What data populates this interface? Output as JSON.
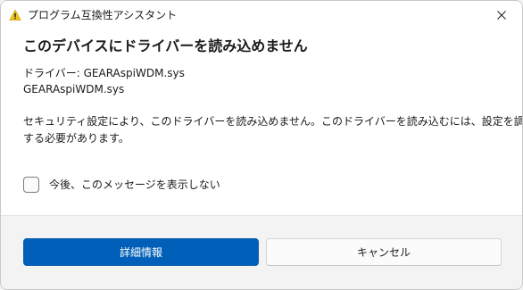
{
  "window": {
    "title": "プログラム互換性アシスタント"
  },
  "dialog": {
    "heading": "このデバイスにドライバーを読み込めません",
    "driver_line": "ドライバー: GEARAspiWDM.sys",
    "driver_file": "GEARAspiWDM.sys",
    "message_line1": "セキュリティ設定により、このドライバーを読み込めません。このドライバーを読み込むには、設定を調整",
    "message_line2": "する必要があります。",
    "checkbox_label": "今後、このメッセージを表示しない",
    "checkbox_checked": false
  },
  "buttons": {
    "details": "詳細情報",
    "cancel": "キャンセル"
  },
  "colors": {
    "primary": "#005fb8",
    "warning": "#f0c419"
  },
  "icons": {
    "title": "warning-icon",
    "close": "close-icon"
  }
}
